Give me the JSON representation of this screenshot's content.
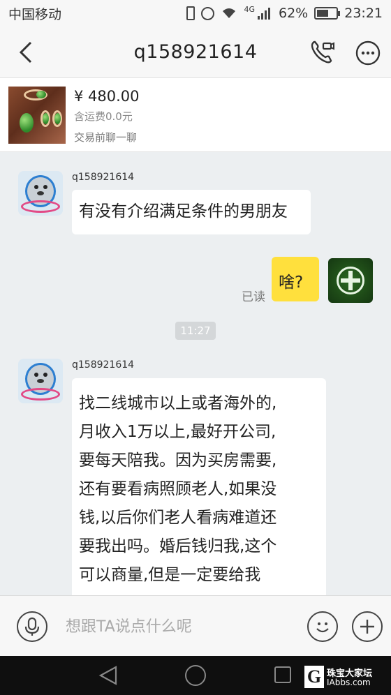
{
  "status_bar": {
    "carrier": "中国移动",
    "network": "4G",
    "battery": "62%",
    "battery_level": 0.62,
    "time": "23:21"
  },
  "header": {
    "title": "q158921614"
  },
  "product": {
    "price": "¥ 480.00",
    "shipping": "含运费0.0元",
    "tip": "交易前聊一聊"
  },
  "chat": {
    "messages": [
      {
        "sender": "q158921614",
        "lines": [
          "有没有介绍满足条件的男朋友"
        ]
      },
      {
        "from_me": true,
        "text": "啥?",
        "read_status": "已读"
      },
      {
        "sender": "q158921614",
        "lines": [
          "找二线城市以上或者海外的,",
          "月收入1万以上,最好开公司,",
          "要每天陪我。因为买房需要,",
          "还有要看病照顾老人,如果没",
          "钱,以后你们老人看病难道还",
          "要我出吗。婚后钱归我,这个",
          "可以商量,但是一定要给我"
        ]
      }
    ],
    "time_divider": "11:27"
  },
  "input_bar": {
    "placeholder": "想跟TA说点什么呢"
  },
  "watermark": {
    "logo": "G",
    "title": "珠宝大家坛",
    "site": "IAbbs.com"
  },
  "icons": {
    "back": "chevron-left-icon",
    "call": "phone-video-icon",
    "more": "more-icon",
    "voice": "microphone-icon",
    "emoji": "smiley-icon",
    "plus": "plus-icon"
  }
}
